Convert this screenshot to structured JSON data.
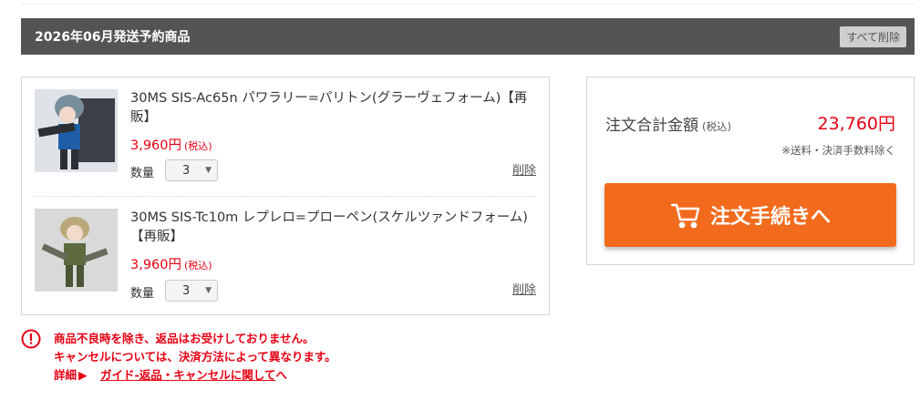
{
  "section": {
    "title": "2026年06月発送予約商品",
    "delete_all_label": "すべて削除"
  },
  "items": [
    {
      "name": "30MS SIS-Ac65n パワラリー=パリトン(グラーヴェフォーム)【再販】",
      "price": "3,960円",
      "tax": "(税込)",
      "qty_label": "数量",
      "qty": "3",
      "delete_label": "削除"
    },
    {
      "name": "30MS SIS-Tc10m レプレロ=プローペン(スケルツァンドフォーム)【再販】",
      "price": "3,960円",
      "tax": "(税込)",
      "qty_label": "数量",
      "qty": "3",
      "delete_label": "削除"
    }
  ],
  "summary": {
    "total_label": "注文合計金額",
    "total_tax": "(税込)",
    "total_value": "23,760円",
    "note": "※送料・決済手数料除く",
    "checkout_label": "注文手続きへ",
    "checkout_icon": "cart-icon"
  },
  "notice": {
    "icon": "alert-icon",
    "line1": "商品不良時を除き、返品はお受けしておりません。",
    "line2": "キャンセルについては、決済方法によって異なります。",
    "detail_label": "詳細",
    "detail_arrow": "▶",
    "link_text": "ガイド-返品・キャンセルに関して",
    "link_suffix": "へ"
  },
  "colors": {
    "header_bg": "#545454",
    "accent_red": "#e60012",
    "checkout_orange": "#f26b1d"
  }
}
